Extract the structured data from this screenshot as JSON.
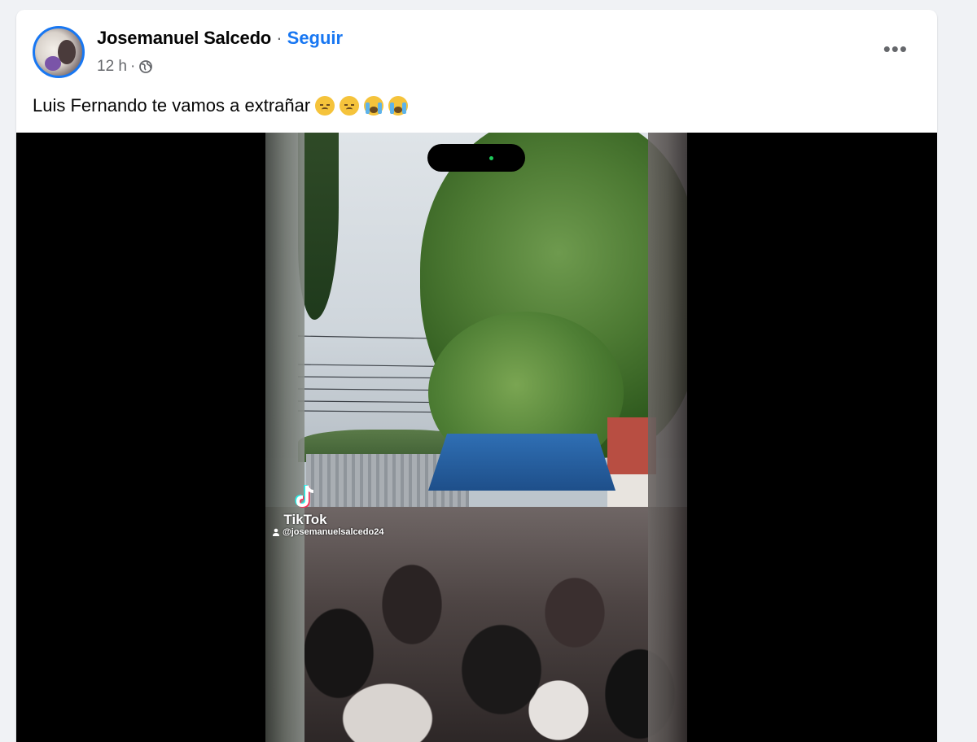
{
  "post": {
    "author": "Josemanuel Salcedo",
    "separator": "·",
    "follow_label": "Seguir",
    "time": "12 h",
    "time_separator": "·",
    "privacy_icon": "globe-icon",
    "more_label": "•••",
    "text": "Luis Fernando te vamos a extrañar",
    "emojis": [
      "sad-face-emoji",
      "sad-face-emoji",
      "crying-face-emoji",
      "crying-face-emoji"
    ]
  },
  "video": {
    "watermark_label": "TikTok",
    "watermark_handle": "@josemanuelsalcedo24"
  },
  "colors": {
    "background": "#f0f2f5",
    "card": "#ffffff",
    "accent": "#1877f2",
    "secondary_text": "#65676b",
    "video_background": "#000000"
  }
}
